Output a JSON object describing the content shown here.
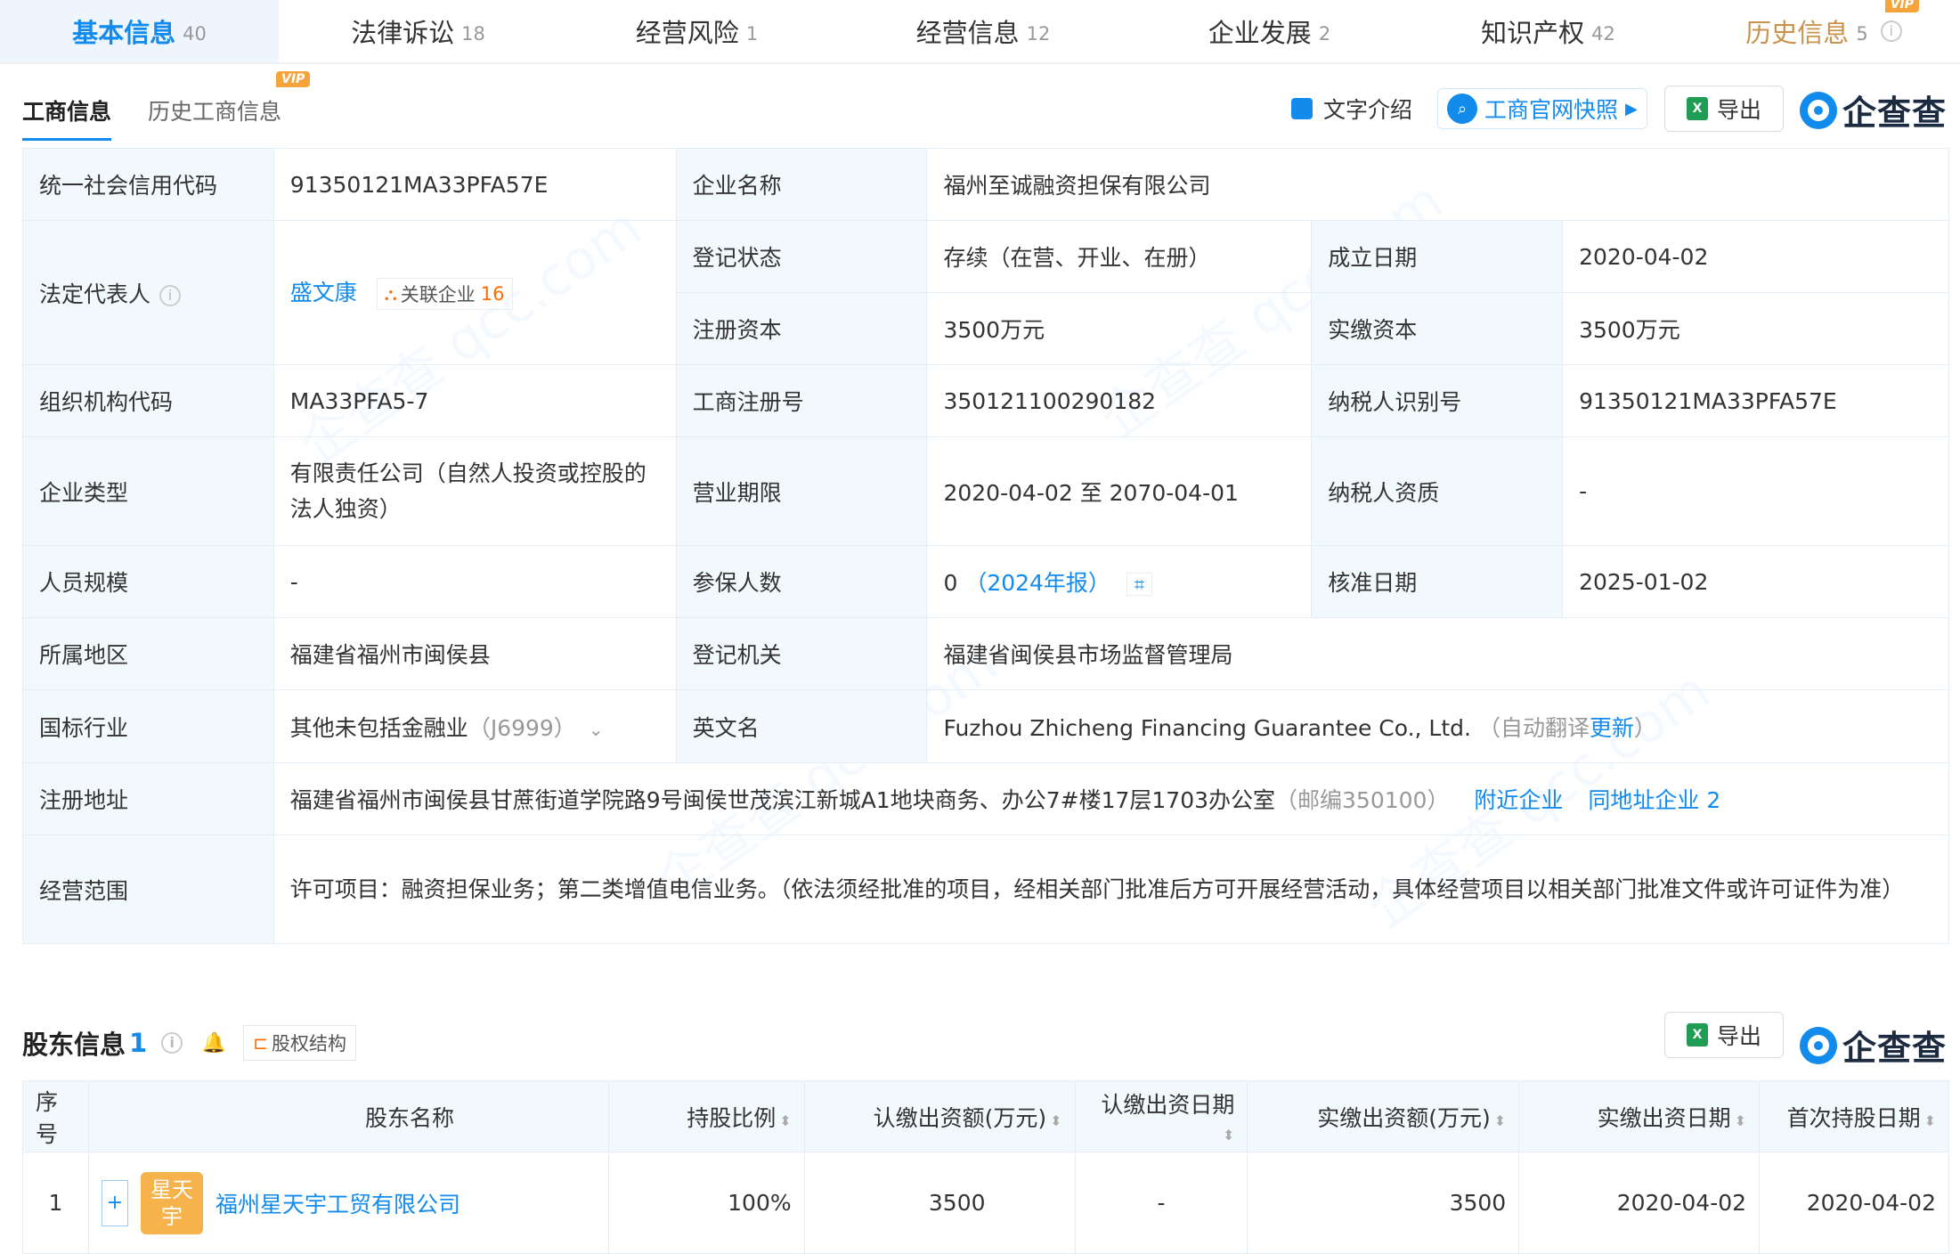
{
  "top_tabs": [
    {
      "label": "基本信息",
      "count": "40"
    },
    {
      "label": "法律诉讼",
      "count": "18"
    },
    {
      "label": "经营风险",
      "count": "1"
    },
    {
      "label": "经营信息",
      "count": "12"
    },
    {
      "label": "企业发展",
      "count": "2"
    },
    {
      "label": "知识产权",
      "count": "42"
    },
    {
      "label": "历史信息",
      "count": "5",
      "badge": "VIP"
    }
  ],
  "sub_tabs": {
    "active": "工商信息",
    "other": "历史工商信息",
    "other_badge": "VIP"
  },
  "toolbar": {
    "text_intro": "文字介绍",
    "snapshot": "工商官网快照",
    "export": "导出",
    "logo": "企查查"
  },
  "info": {
    "credit_code_label": "统一社会信用代码",
    "credit_code": "91350121MA33PFA57E",
    "company_name_label": "企业名称",
    "company_name": "福州至诚融资担保有限公司",
    "legal_rep_label": "法定代表人",
    "legal_rep": "盛文康",
    "related_label": "关联企业",
    "related_count": "16",
    "status_label": "登记状态",
    "status": "存续（在营、开业、在册）",
    "founded_label": "成立日期",
    "founded": "2020-04-02",
    "reg_capital_label": "注册资本",
    "reg_capital": "3500万元",
    "paid_capital_label": "实缴资本",
    "paid_capital": "3500万元",
    "org_code_label": "组织机构代码",
    "org_code": "MA33PFA5-7",
    "reg_no_label": "工商注册号",
    "reg_no": "350121100290182",
    "tax_id_label": "纳税人识别号",
    "tax_id": "91350121MA33PFA57E",
    "type_label": "企业类型",
    "type": "有限责任公司（自然人投资或控股的法人独资）",
    "term_label": "营业期限",
    "term": "2020-04-02 至 2070-04-01",
    "tax_qual_label": "纳税人资质",
    "tax_qual": "-",
    "staff_label": "人员规模",
    "staff": "-",
    "insured_label": "参保人数",
    "insured": "0",
    "insured_report": "（2024年报）",
    "approved_label": "核准日期",
    "approved": "2025-01-02",
    "region_label": "所属地区",
    "region": "福建省福州市闽侯县",
    "authority_label": "登记机关",
    "authority": "福建省闽侯县市场监督管理局",
    "industry_label": "国标行业",
    "industry": "其他未包括金融业",
    "industry_code": "（J6999）",
    "english_label": "英文名",
    "english": "Fuzhou Zhicheng Financing Guarantee Co., Ltd.",
    "english_note": "（自动翻译",
    "english_update": "更新",
    "english_close": "）",
    "address_label": "注册地址",
    "address": "福建省福州市闽侯县甘蔗街道学院路9号闽侯世茂滨江新城A1地块商务、办公7#楼17层1703办公室",
    "postcode": "（邮编350100）",
    "nearby": "附近企业",
    "same_addr": "同地址企业 2",
    "scope_label": "经营范围",
    "scope": "许可项目：融资担保业务；第二类增值电信业务。（依法须经批准的项目，经相关部门批准后方可开展经营活动，具体经营项目以相关部门批准文件或许可证件为准）"
  },
  "shareholders": {
    "title": "股东信息",
    "count": "1",
    "structure": "股权结构",
    "export": "导出",
    "logo": "企查查",
    "headers": [
      "序号",
      "股东名称",
      "持股比例",
      "认缴出资额(万元)",
      "认缴出资日期",
      "实缴出资额(万元)",
      "实缴出资日期",
      "首次持股日期"
    ],
    "rows": [
      {
        "index": "1",
        "avatar": "星天宇",
        "name": "福州星天宇工贸有限公司",
        "ratio": "100%",
        "subscribed": "3500",
        "sub_date": "-",
        "paid": "3500",
        "paid_date": "2020-04-02",
        "first_date": "2020-04-02"
      }
    ]
  }
}
